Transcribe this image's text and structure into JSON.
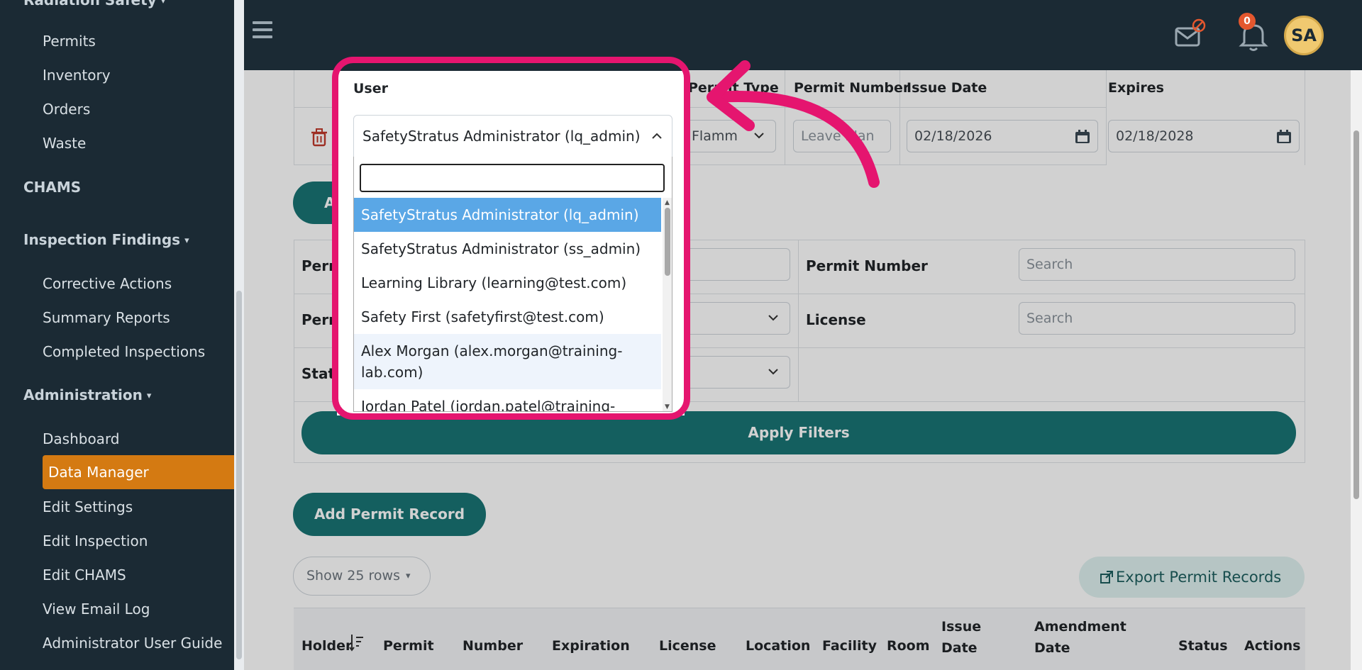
{
  "sidebar": {
    "truncated_section": "Radiation Safety",
    "radiation_items": [
      "Permits",
      "Inventory",
      "Orders",
      "Waste"
    ],
    "chams_label": "CHAMS",
    "inspection_findings_label": "Inspection Findings",
    "inspection_items": [
      "Corrective Actions",
      "Summary Reports",
      "Completed Inspections"
    ],
    "administration_label": "Administration",
    "admin_items": [
      "Dashboard",
      "Data Manager",
      "Edit Settings",
      "Edit Inspection",
      "Edit CHAMS",
      "View Email Log",
      "Administrator User Guide"
    ],
    "active_item": "Data Manager"
  },
  "topbar": {
    "notification_count": "0",
    "avatar_initials": "SA"
  },
  "form_table": {
    "headers": [
      "User",
      "Permit Type",
      "Permit Number",
      "Issue Date",
      "Expires"
    ],
    "permit_type_value": "Flamm",
    "permit_number_placeholder": "Leave blan",
    "issue_date": "02/18/2026",
    "expires_date": "02/18/2028",
    "add_button_partial": "Add"
  },
  "filters": {
    "permit_holder_label": "Permit H",
    "permit_label": "Permit",
    "status_label": "Status",
    "permit_number_label": "Permit Number",
    "permit_number_placeholder": "Search",
    "license_label": "License",
    "license_placeholder": "Search",
    "apply_button": "Apply Filters"
  },
  "actions": {
    "add_permit_record": "Add Permit Record",
    "show_rows": "Show 25 rows",
    "export": "Export Permit Records"
  },
  "results_table": {
    "headers": [
      "Holder",
      "Permit",
      "Number",
      "Expiration",
      "License",
      "Location",
      "Facility",
      "Room",
      "Issue Date",
      "Amendment Date",
      "Status",
      "Actions"
    ]
  },
  "user_dropdown": {
    "label": "User",
    "selected": "SafetyStratus Administrator (lq_admin)",
    "search_value": "",
    "options": [
      "SafetyStratus Administrator (lq_admin)",
      "SafetyStratus Administrator (ss_admin)",
      "Learning Library (learning@test.com)",
      "Safety First (safetyfirst@test.com)",
      "Alex Morgan (alex.morgan@training-lab.com)",
      "Jordan Patel (jordan.patel@training-"
    ]
  },
  "colors": {
    "sidebar_bg": "#1b2a34",
    "active_item_bg": "#d47a12",
    "teal_button": "#197474",
    "highlight": "#e5156f",
    "selected_option": "#5aa7e6"
  }
}
